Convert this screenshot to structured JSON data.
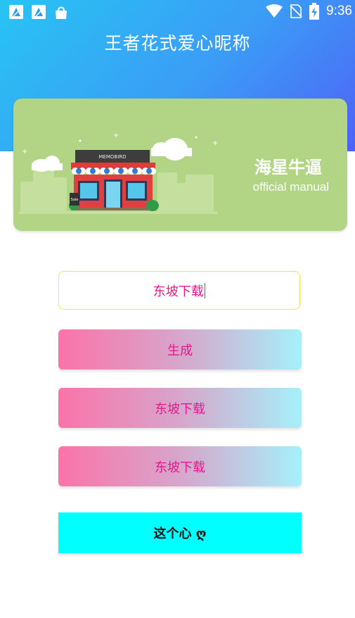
{
  "status_bar": {
    "time": "9:36",
    "left_icons": [
      "notification-app-icon",
      "notification-app-icon",
      "shopping-bag-icon"
    ],
    "right_icons": [
      "wifi-icon",
      "no-sim-icon",
      "battery-charging-icon"
    ]
  },
  "header": {
    "title": "王者花式爱心昵称"
  },
  "banner": {
    "title": "海星牛逼",
    "subtitle": "official manual",
    "store_sign": "MEMOBIRD",
    "sale_sign": "Sale"
  },
  "input": {
    "value": "东坡下载"
  },
  "buttons": {
    "generate": "生成",
    "prefix_variant": "东坡下载",
    "suffix_variant": "东坡下载",
    "heart": "这个心 ღ"
  },
  "colors": {
    "header_gradient": [
      "#27c4f3",
      "#4f62f7"
    ],
    "banner_bg": "#b1d585",
    "accent_text": "#e8168f",
    "button_gradient": [
      "#fb73a9",
      "#a6f0fa"
    ],
    "heart_button_bg": "#00ffff",
    "input_border": "#f2e34a"
  }
}
